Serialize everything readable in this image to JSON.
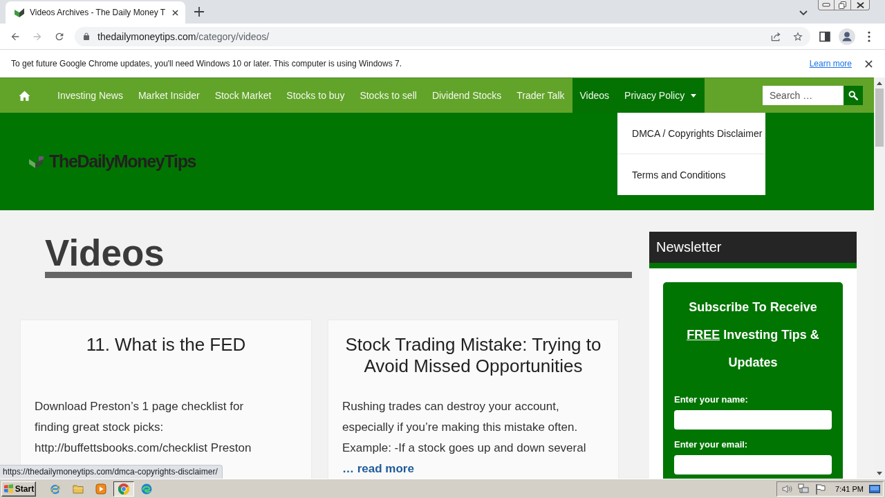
{
  "browser": {
    "tab": {
      "title": "Videos Archives - The Daily Money T",
      "selected": true
    },
    "address": {
      "host": "thedailymoneytips.com",
      "path": "/category/videos/"
    }
  },
  "infobar": {
    "message": "To get future Google Chrome updates, you'll need Windows 10 or later. This computer is using Windows 7.",
    "link": "Learn more"
  },
  "nav": {
    "items": [
      {
        "label": "Investing News",
        "selected": false
      },
      {
        "label": "Market Insider",
        "selected": false
      },
      {
        "label": "Stock Market",
        "selected": false
      },
      {
        "label": "Stocks to buy",
        "selected": false
      },
      {
        "label": "Stocks to sell",
        "selected": false
      },
      {
        "label": "Dividend Stocks",
        "selected": false
      },
      {
        "label": "Trader Talk",
        "selected": false
      },
      {
        "label": "Videos",
        "selected": true
      },
      {
        "label": "Privacy Policy",
        "selected": true,
        "expanded": true,
        "submenu": [
          "DMCA / Copyrights Disclaimer",
          "Terms and Conditions"
        ]
      }
    ],
    "search": {
      "placeholder": "Search …"
    }
  },
  "header": {
    "logo_text": "TheDailyMoneyTips"
  },
  "main": {
    "title": "Videos",
    "posts": [
      {
        "title": "11. What is the FED",
        "excerpt_lines": [
          "Download Preston’s 1 page checklist for",
          "finding great stock picks:",
          "http://buffettsbooks.com/checklist Preston"
        ]
      },
      {
        "title": "Stock Trading Mistake: Trying to Avoid Missed Opportunities",
        "excerpt_lines": [
          "Rushing trades can destroy your account,",
          "especially if you’re making this mistake often.",
          "Example: -If a stock goes up and down several"
        ],
        "read_more": "… read more"
      }
    ]
  },
  "sidebar": {
    "widget_title": "Newsletter",
    "form": {
      "heading": [
        {
          "text": "Subscribe To Receive ",
          "underline": false
        },
        {
          "text": "FREE",
          "underline": true
        },
        {
          "text": " Investing Tips & Updates",
          "underline": false
        }
      ],
      "fields": [
        {
          "label": "Enter your name:"
        },
        {
          "label": "Enter your email:"
        }
      ]
    }
  },
  "status_url": "https://thedailymoneytips.com/dmca-copyrights-disclaimer/",
  "taskbar": {
    "start": "Start",
    "clock": "7:41 PM"
  }
}
